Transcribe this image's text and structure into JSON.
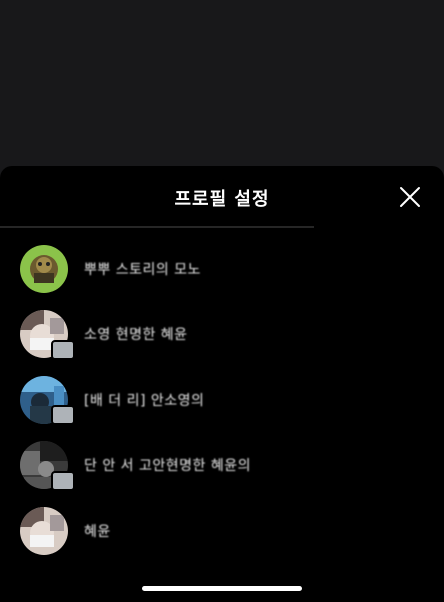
{
  "sheet": {
    "title": "프로필 설정",
    "close_icon": "close-icon"
  },
  "profiles": [
    {
      "name": "뿌뿌 스토리의 모노",
      "avatar_color": "#8ac24a"
    },
    {
      "name": "소영 현명한 혜윤",
      "avatar_color": "#c9b8ad"
    },
    {
      "name": "[배 더 리] 안소영의",
      "avatar_color": "#3a6f9a"
    },
    {
      "name": "단 안 서 고안현명한 혜윤의",
      "avatar_color": "#4a4a4a"
    },
    {
      "name": "혜윤",
      "avatar_color": "#c9b8ad"
    }
  ]
}
